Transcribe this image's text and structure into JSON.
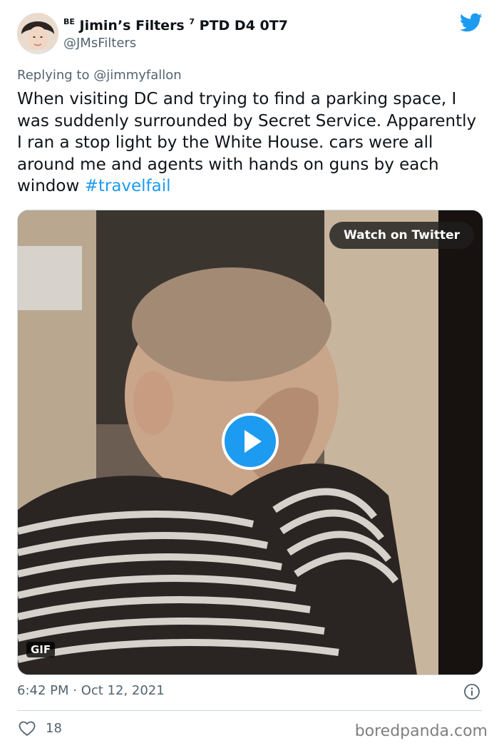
{
  "author": {
    "prefix": "BE",
    "name": "Jimin’s Filters",
    "suffix_sup": "7",
    "suffix": "PTD D4 0T7",
    "handle": "@JMsFilters"
  },
  "reply": {
    "label": "Replying to ",
    "target": "@jimmyfallon"
  },
  "tweet": {
    "text": "When visiting DC and trying to find a parking space, I was suddenly surrounded by Secret Service. Apparently I ran a stop light by the White House. cars were all around me and agents with hands on guns by each window ",
    "hashtag": "#travelfail"
  },
  "media": {
    "watch_label": "Watch on Twitter",
    "badge": "GIF"
  },
  "meta": {
    "timestamp": "6:42 PM · Oct 12, 2021",
    "likes": "18"
  },
  "watermark": {
    "text": "boredpanda.com"
  },
  "colors": {
    "accent": "#1d9bf0",
    "secondary_text": "#536471"
  }
}
